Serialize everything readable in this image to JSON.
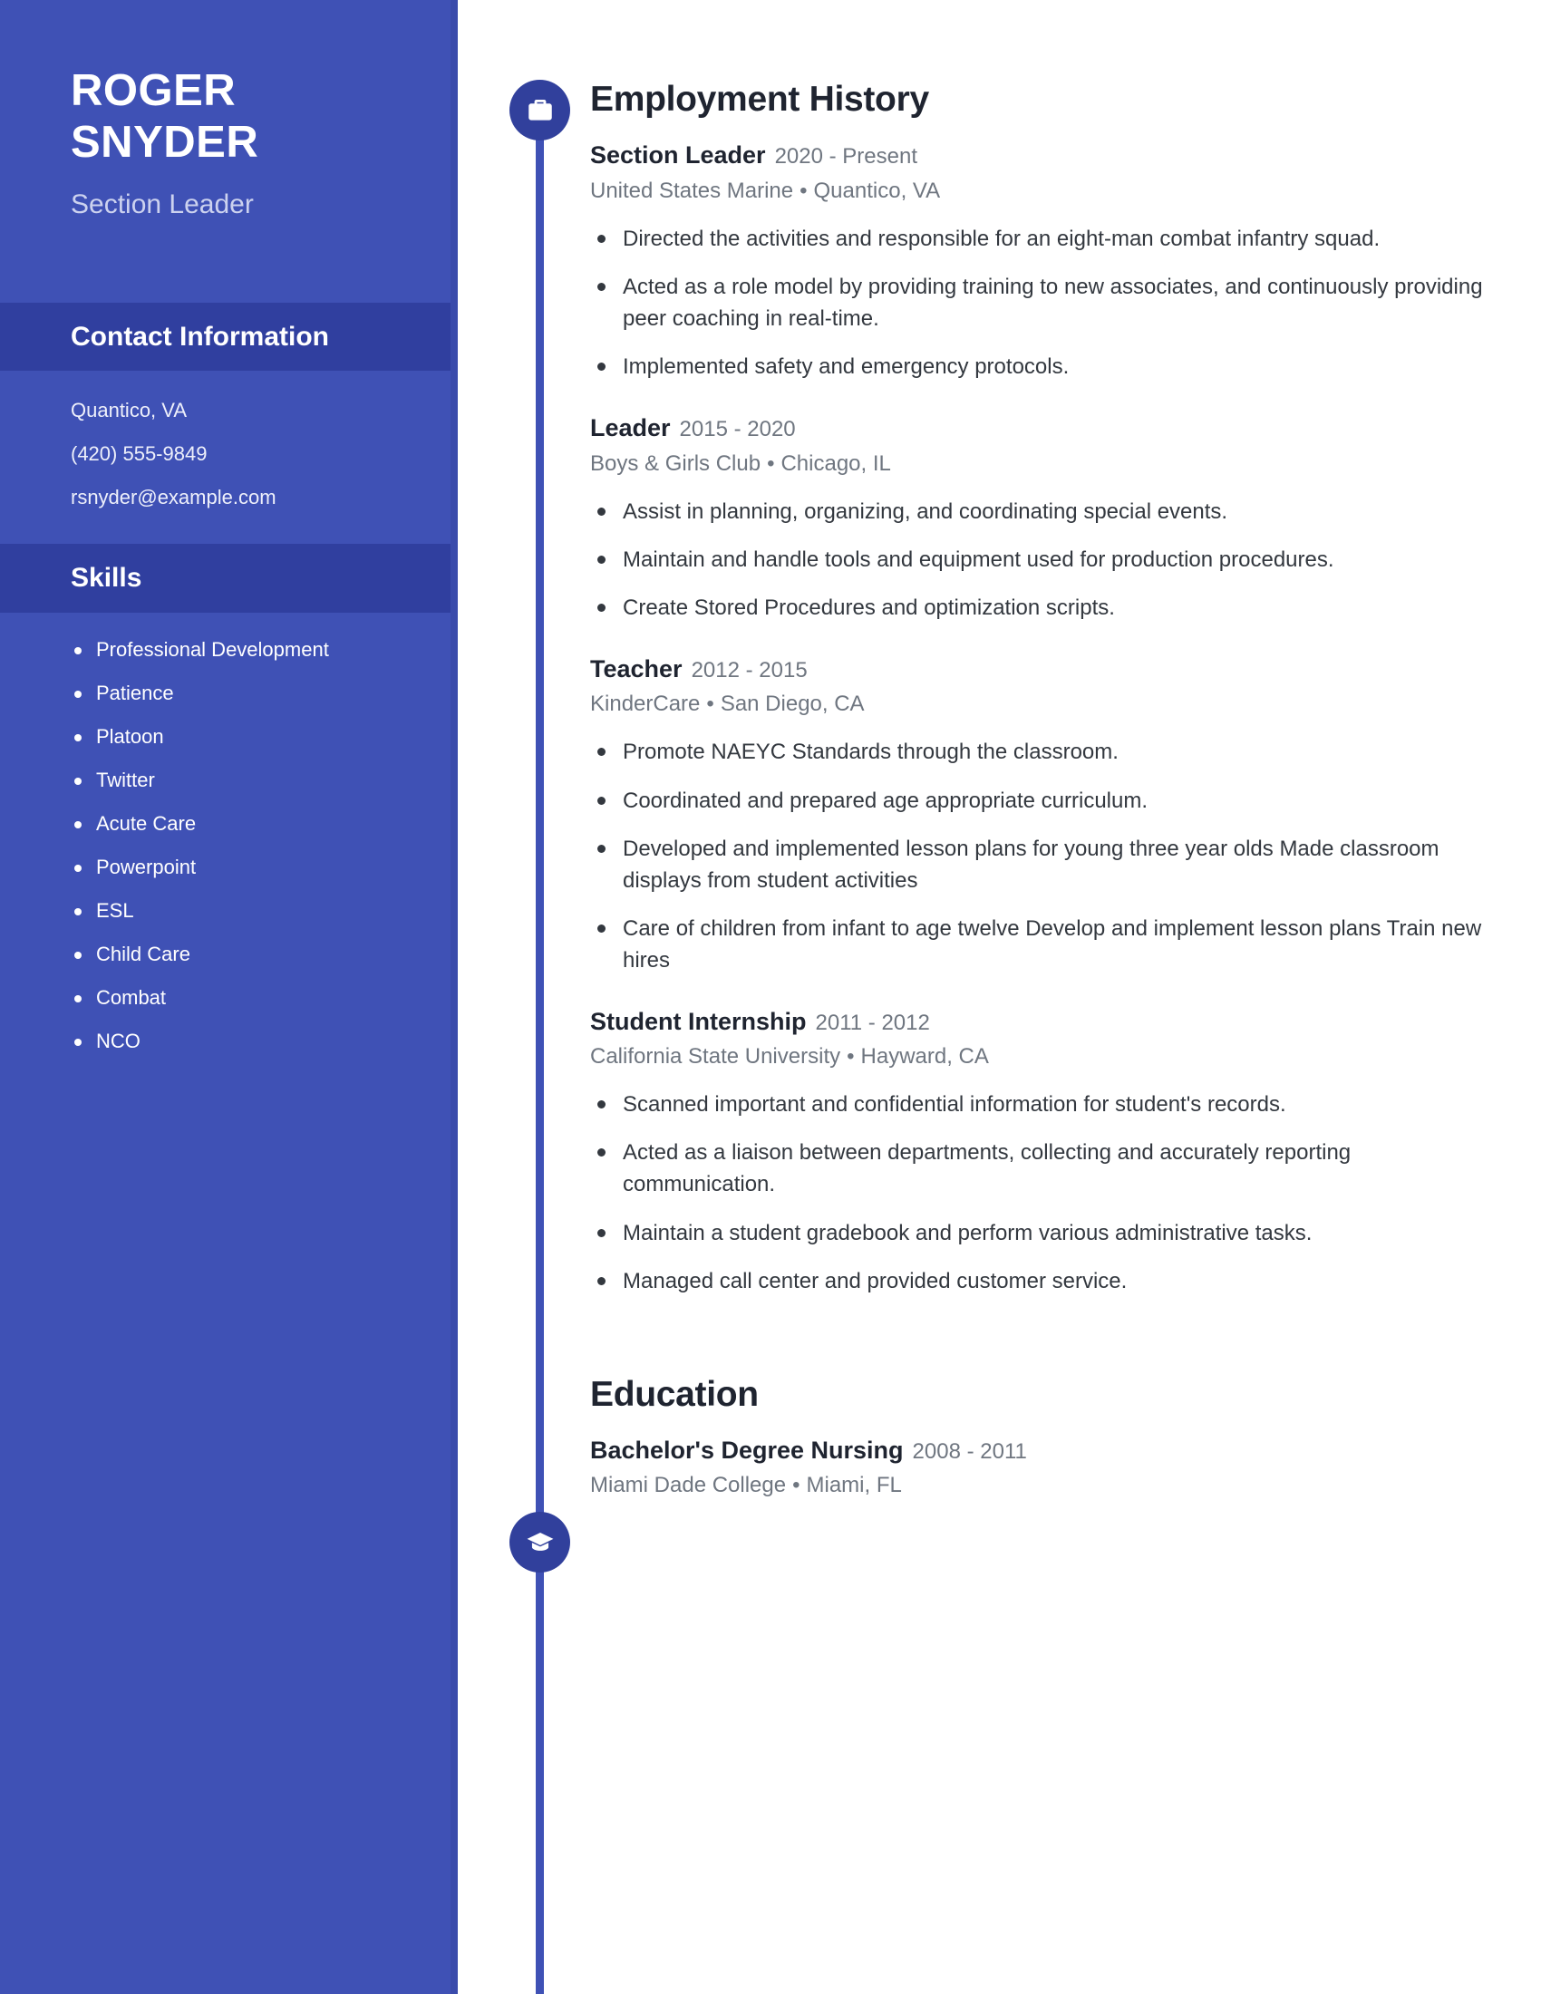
{
  "theme": {
    "sidebar_bg": "#3f51b5",
    "sidebar_band_bg": "#303f9f",
    "marker_bg": "#31409c",
    "timeline_color": "#3f51b5",
    "heading_color": "#1f2430",
    "muted_color": "#6f7680"
  },
  "sidebar": {
    "name_first": "ROGER",
    "name_last": "SNYDER",
    "job_title": "Section Leader",
    "contact_heading": "Contact Information",
    "contact": [
      "Quantico, VA",
      "(420) 555-9849",
      "rsnyder@example.com"
    ],
    "skills_heading": "Skills",
    "skills": [
      "Professional Development",
      "Patience",
      "Platoon",
      "Twitter",
      "Acute Care",
      "Powerpoint",
      "ESL",
      "Child Care",
      "Combat",
      "NCO"
    ]
  },
  "employment": {
    "heading": "Employment History",
    "icon": "briefcase-icon",
    "entries": [
      {
        "title": "Section Leader",
        "dates": "2020 - Present",
        "company": "United States Marine",
        "location": "Quantico, VA",
        "bullets": [
          "Directed the activities and responsible for an eight-man combat infantry squad.",
          "Acted as a role model by providing training to new associates, and continuously providing peer coaching in real-time.",
          "Implemented safety and emergency protocols."
        ]
      },
      {
        "title": "Leader",
        "dates": "2015 - 2020",
        "company": "Boys & Girls Club",
        "location": "Chicago, IL",
        "bullets": [
          "Assist in planning, organizing, and coordinating special events.",
          "Maintain and handle tools and equipment used for production procedures.",
          "Create Stored Procedures and optimization scripts."
        ]
      },
      {
        "title": "Teacher",
        "dates": "2012 - 2015",
        "company": "KinderCare",
        "location": "San Diego, CA",
        "bullets": [
          "Promote NAEYC Standards through the classroom.",
          "Coordinated and prepared age appropriate curriculum.",
          "Developed and implemented lesson plans for young three year olds Made classroom displays from student activities",
          "Care of children from infant to age twelve Develop and implement lesson plans Train new hires"
        ]
      },
      {
        "title": "Student Internship",
        "dates": "2011 - 2012",
        "company": "California State University",
        "location": "Hayward, CA",
        "bullets": [
          "Scanned important and confidential information for student's records.",
          "Acted as a liaison between departments, collecting and accurately reporting communication.",
          "Maintain a student gradebook and perform various administrative tasks.",
          "Managed call center and provided customer service."
        ]
      }
    ]
  },
  "education": {
    "heading": "Education",
    "icon": "graduation-cap-icon",
    "entries": [
      {
        "title": "Bachelor's Degree Nursing",
        "dates": "2008 - 2011",
        "school": "Miami Dade College",
        "location": "Miami, FL"
      }
    ]
  },
  "separator": "•"
}
